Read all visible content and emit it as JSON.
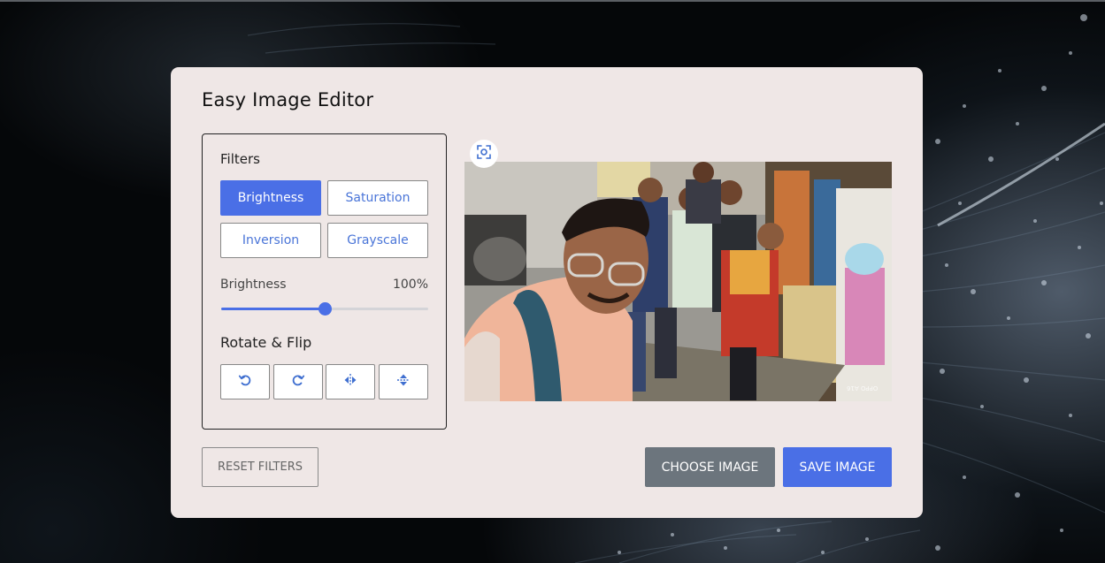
{
  "app": {
    "title": "Easy Image Editor"
  },
  "filters": {
    "heading": "Filters",
    "options": [
      {
        "label": "Brightness",
        "active": true
      },
      {
        "label": "Saturation",
        "active": false
      },
      {
        "label": "Inversion",
        "active": false
      },
      {
        "label": "Grayscale",
        "active": false
      }
    ]
  },
  "slider": {
    "label": "Brightness",
    "value_text": "100%",
    "fraction": 0.5
  },
  "rotate_flip": {
    "heading": "Rotate & Flip",
    "buttons": [
      {
        "icon": "rotate-left-icon"
      },
      {
        "icon": "rotate-right-icon"
      },
      {
        "icon": "flip-horizontal-icon"
      },
      {
        "icon": "flip-vertical-icon"
      }
    ]
  },
  "preview": {
    "focus_icon": "scan-focus-icon",
    "image": "group-selfie-photo",
    "watermark": "OPPO A16"
  },
  "actions": {
    "reset": "RESET FILTERS",
    "choose": "CHOOSE IMAGE",
    "save": "SAVE IMAGE"
  },
  "colors": {
    "accent": "#4a6fe6",
    "secondary": "#6c757d",
    "card": "#efe7e6"
  }
}
